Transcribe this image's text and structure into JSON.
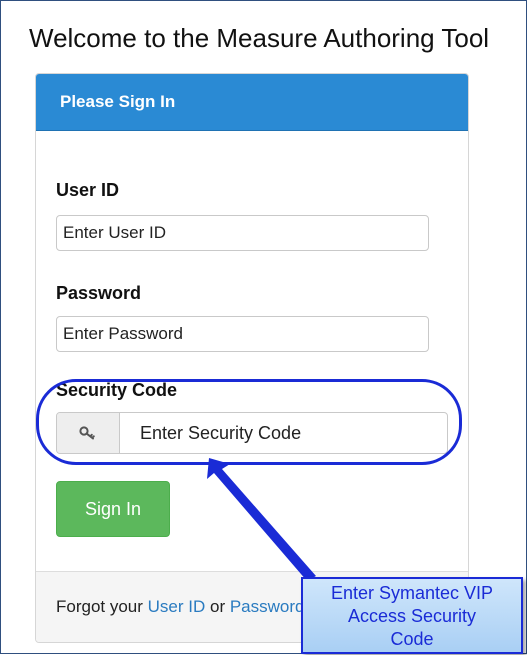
{
  "welcome_title": "Welcome to the Measure Authoring Tool",
  "panel": {
    "heading": "Please Sign In",
    "user_id": {
      "label": "User ID",
      "placeholder": "Enter User ID"
    },
    "password": {
      "label": "Password",
      "placeholder": "Enter Password"
    },
    "security_code": {
      "label": "Security Code",
      "placeholder": "Enter Security Code",
      "icon": "key-icon"
    },
    "sign_in_label": "Sign In",
    "footer": {
      "prefix": "Forgot your ",
      "user_id_link": "User ID",
      "middle": " or ",
      "password_link": "Password?"
    }
  },
  "annotation": {
    "callout_line1": "Enter Symantec VIP",
    "callout_line2": "Access Security",
    "callout_line3": "Code",
    "color": "#1a2bd6"
  },
  "colors": {
    "header_blue": "#2a8ad4",
    "button_green": "#5cb85c",
    "link_blue": "#2a7bc0"
  }
}
